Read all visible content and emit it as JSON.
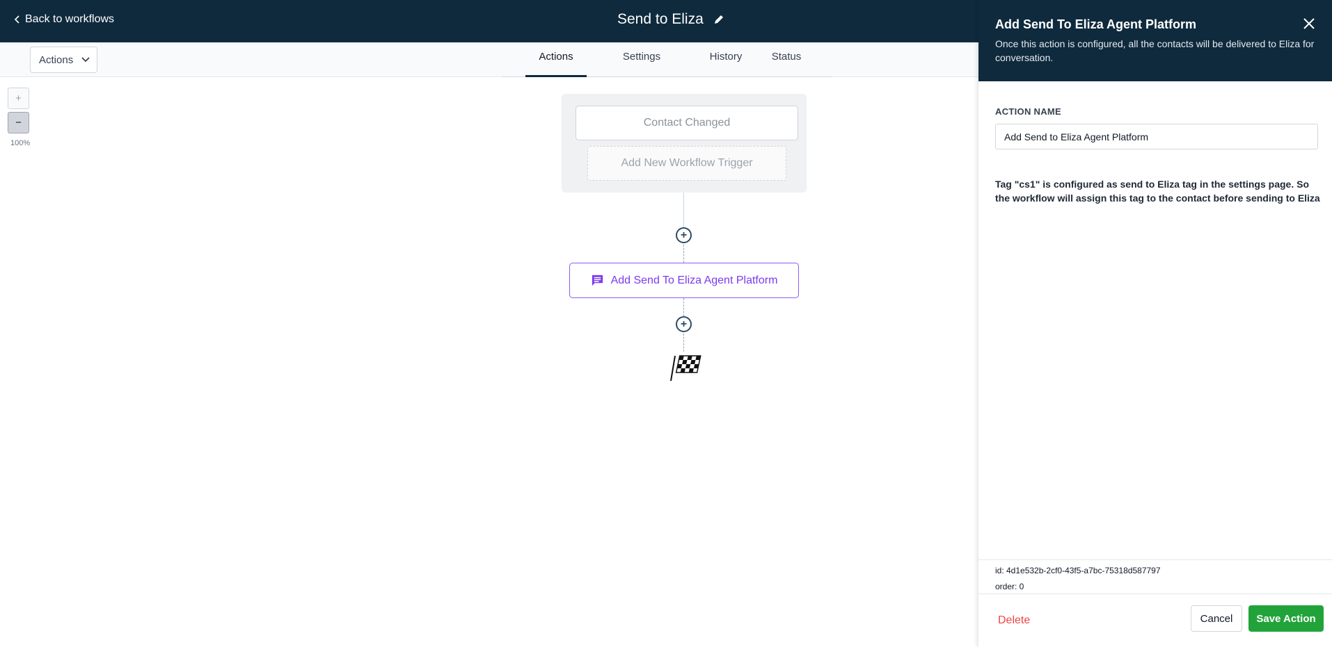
{
  "header": {
    "back_label": "Back to workflows",
    "workflow_title": "Send to Eliza"
  },
  "toolbar": {
    "actions_dropdown": "Actions",
    "tabs": [
      {
        "label": "Actions",
        "active": true
      },
      {
        "label": "Settings",
        "active": false
      },
      {
        "label": "History",
        "active": false
      },
      {
        "label": "Status",
        "active": false
      }
    ]
  },
  "zoom": {
    "plus": "+",
    "minus": "−",
    "level": "100%"
  },
  "canvas": {
    "trigger_label": "Contact Changed",
    "add_trigger_label": "Add New Workflow Trigger",
    "action_label": "Add Send To Eliza Agent Platform",
    "action_icon": "chat-icon",
    "end_icon": "checkered-flag-icon"
  },
  "panel": {
    "title": "Add Send To Eliza Agent Platform",
    "description": "Once this action is configured, all the contacts will be delivered to Eliza for conversation.",
    "field_label": "ACTION NAME",
    "field_value": "Add Send to Eliza Agent Platform",
    "note": "Tag \"cs1\" is configured as send to Eliza tag in the settings page. So the workflow will assign this tag to the contact before sending to Eliza",
    "meta_id": "id: 4d1e532b-2cf0-43f5-a7bc-75318d587797",
    "meta_order": "order: 0",
    "delete_label": "Delete",
    "cancel_label": "Cancel",
    "save_label": "Save Action"
  },
  "colors": {
    "header_bg": "#0f2a3d",
    "accent_purple": "#7c3aed",
    "save_green": "#22a33a",
    "delete_red": "#ef4444"
  }
}
